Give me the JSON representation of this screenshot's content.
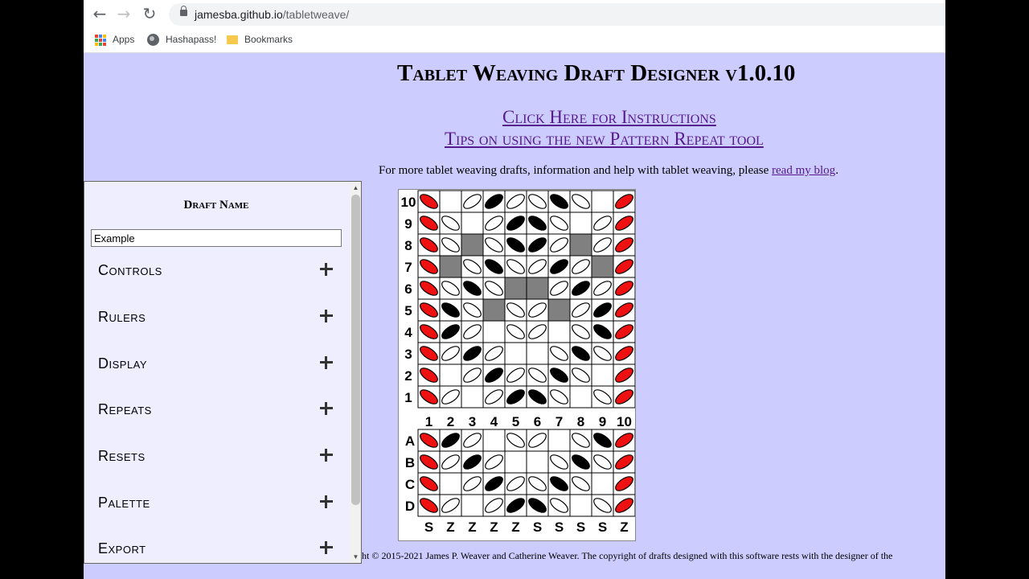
{
  "browser": {
    "url_host": "jamesba.github.io",
    "url_path": "/tabletweave/",
    "bookmarks": [
      {
        "label": "Apps",
        "icon": "apps-grid-icon"
      },
      {
        "label": "Hashapass!",
        "icon": "globe-icon"
      },
      {
        "label": "Bookmarks",
        "icon": "folder-icon"
      }
    ]
  },
  "page": {
    "title": "Tablet Weaving Draft Designer v1.0.10",
    "instructions_link": "Click Here for Instructions",
    "tips_link": "Tips on using the new Pattern Repeat tool",
    "intro_text": "For more tablet weaving drafts, information and help with tablet weaving, please ",
    "blog_link": "read my blog",
    "intro_end": ".",
    "footer": "ht © 2015-2021 James P. Weaver and Catherine Weaver. The copyright of drafts designed with this software rests with the designer of the"
  },
  "sidebar": {
    "draft_name_label": "Draft Name",
    "draft_name_value": "Example",
    "sections": [
      "Controls",
      "Rulers",
      "Display",
      "Repeats",
      "Resets",
      "Palette",
      "Export"
    ]
  },
  "colors": {
    "page_bg": "#ccccff",
    "sidebar_bg": "#eeeeff",
    "link": "#551a8b",
    "thread_red": "#ee1111",
    "thread_black": "#000000",
    "thread_white": "#ffffff",
    "cell_grey": "#808080"
  },
  "draft": {
    "row_labels": [
      "10",
      "9",
      "8",
      "7",
      "6",
      "5",
      "4",
      "3",
      "2",
      "1"
    ],
    "tablet_numbers": [
      "1",
      "2",
      "3",
      "4",
      "5",
      "6",
      "7",
      "8",
      "9",
      "10"
    ],
    "hole_labels": [
      "A",
      "B",
      "C",
      "D"
    ],
    "threading_directions": [
      "S",
      "Z",
      "Z",
      "Z",
      "Z",
      "S",
      "S",
      "S",
      "S",
      "Z"
    ],
    "pattern_rows": [
      [
        "R/",
        "W ",
        "W\\",
        "K\\",
        "W\\",
        "W/",
        "K/",
        "W/",
        "W ",
        "R\\"
      ],
      [
        "R/",
        "W/",
        "W ",
        "W\\",
        "K\\",
        "K/",
        "W/",
        "W ",
        "W\\",
        "R\\"
      ],
      [
        "R/",
        "W/",
        "G ",
        "W/",
        "K/",
        "K\\",
        "W\\",
        "G ",
        "W\\",
        "R\\"
      ],
      [
        "R/",
        "G ",
        "W/",
        "K/",
        "W/",
        "W\\",
        "K\\",
        "W\\",
        "G ",
        "R\\"
      ],
      [
        "R/",
        "W/",
        "K/",
        "W/",
        "G ",
        "G ",
        "W\\",
        "K\\",
        "W\\",
        "R\\"
      ],
      [
        "R/",
        "K/",
        "W/",
        "G ",
        "W/",
        "W\\",
        "G ",
        "W\\",
        "K\\",
        "R\\"
      ],
      [
        "R/",
        "K\\",
        "W\\",
        "W ",
        "W/",
        "W\\",
        "W ",
        "W/",
        "K/",
        "R\\"
      ],
      [
        "R/",
        "W\\",
        "K\\",
        "W\\",
        "W ",
        "W ",
        "W/",
        "K/",
        "W/",
        "R\\"
      ],
      [
        "R/",
        "W ",
        "W\\",
        "K\\",
        "W\\",
        "W/",
        "K/",
        "W/",
        "W ",
        "R\\"
      ],
      [
        "R/",
        "W\\",
        "W ",
        "W\\",
        "K\\",
        "K/",
        "W/",
        "W ",
        "W/",
        "R\\"
      ]
    ],
    "threading_rows": [
      [
        "R/",
        "K\\",
        "W\\",
        "W ",
        "W/",
        "W\\",
        "W ",
        "W/",
        "K/",
        "R\\"
      ],
      [
        "R/",
        "W\\",
        "K\\",
        "W\\",
        "W ",
        "W ",
        "W/",
        "K/",
        "W/",
        "R\\"
      ],
      [
        "R/",
        "W ",
        "W\\",
        "K\\",
        "W\\",
        "W/",
        "K/",
        "W/",
        "W ",
        "R\\"
      ],
      [
        "R/",
        "W\\",
        "W ",
        "W\\",
        "K\\",
        "K/",
        "W/",
        "W ",
        "W/",
        "R\\"
      ]
    ]
  }
}
